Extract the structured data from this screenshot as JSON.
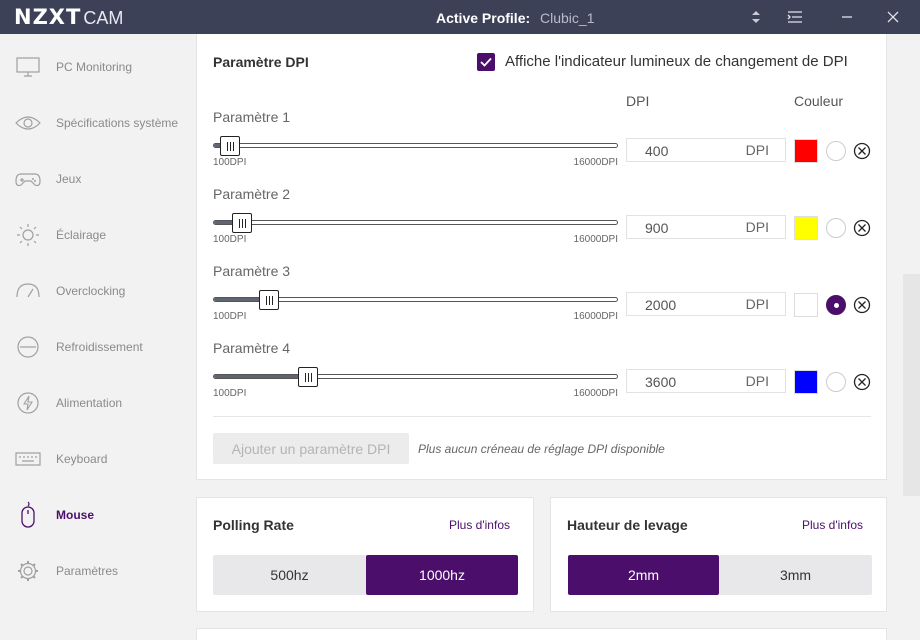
{
  "app": {
    "logo_bold": "NZXT",
    "logo_light": "CAM"
  },
  "titlebar": {
    "profile_label": "Active Profile:",
    "profile_value": "Clubic_1"
  },
  "sidebar": {
    "items": [
      {
        "label": "PC Monitoring",
        "icon": "monitor-icon"
      },
      {
        "label": "Spécifications système",
        "icon": "eye-icon"
      },
      {
        "label": "Jeux",
        "icon": "gamepad-icon"
      },
      {
        "label": "Éclairage",
        "icon": "sun-icon"
      },
      {
        "label": "Overclocking",
        "icon": "gauge-icon"
      },
      {
        "label": "Refroidissement",
        "icon": "cooling-icon"
      },
      {
        "label": "Alimentation",
        "icon": "power-icon"
      },
      {
        "label": "Keyboard",
        "icon": "keyboard-icon"
      },
      {
        "label": "Mouse",
        "icon": "mouse-icon"
      },
      {
        "label": "Paramètres",
        "icon": "gear-icon"
      }
    ],
    "active": "Mouse"
  },
  "dpi": {
    "title": "Paramètre DPI",
    "indicator_label": "Affiche l'indicateur lumineux de changement de DPI",
    "indicator_checked": true,
    "col_dpi": "DPI",
    "col_color": "Couleur",
    "unit": "DPI",
    "range_min": "100DPI",
    "range_max": "16000DPI",
    "settings": [
      {
        "label": "Paramètre 1",
        "value": "400",
        "color": "#ff0000",
        "selected": false
      },
      {
        "label": "Paramètre 2",
        "value": "900",
        "color": "#ffff00",
        "selected": false
      },
      {
        "label": "Paramètre 3",
        "value": "2000",
        "color": "#ffffff",
        "selected": true
      },
      {
        "label": "Paramètre 4",
        "value": "3600",
        "color": "#0000ff",
        "selected": false
      }
    ],
    "add_button": "Ajouter un paramètre DPI",
    "add_note": "Plus aucun créneau de réglage DPI disponible"
  },
  "polling": {
    "title": "Polling Rate",
    "info": "Plus d'infos",
    "options": [
      "500hz",
      "1000hz"
    ],
    "selected": "1000hz"
  },
  "lift": {
    "title": "Hauteur de levage",
    "info": "Plus d'infos",
    "options": [
      "2mm",
      "3mm"
    ],
    "selected": "2mm"
  },
  "colors": {
    "accent": "#4b0f6b",
    "titlebar": "#3c4158"
  }
}
